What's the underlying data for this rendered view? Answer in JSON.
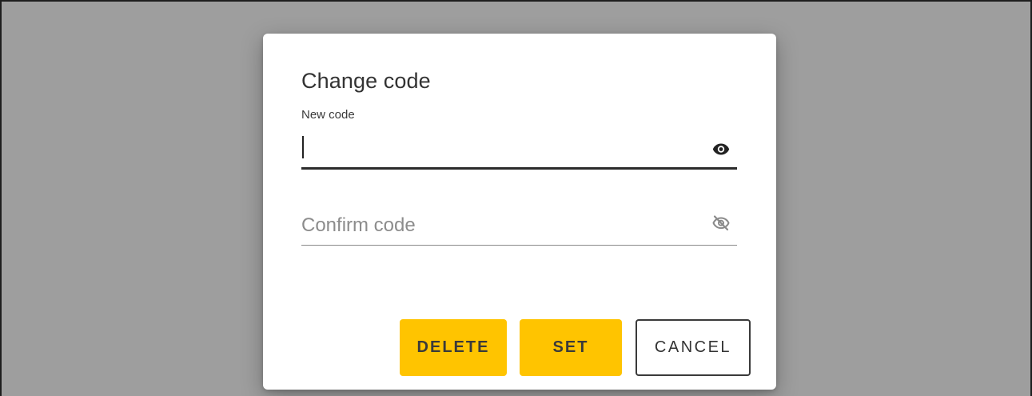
{
  "dialog": {
    "title": "Change code",
    "new_code": {
      "label": "New code",
      "value": "",
      "visibility_icon": "eye-icon"
    },
    "confirm_code": {
      "placeholder": "Confirm code",
      "value": "",
      "visibility_icon": "eye-off-icon"
    },
    "buttons": {
      "delete": "DELETE",
      "set": "SET",
      "cancel": "CANCEL"
    }
  },
  "colors": {
    "overlay": "#9e9e9e",
    "dialog_bg": "#ffffff",
    "accent": "#ffc400",
    "text": "#333333",
    "placeholder": "#8c8c8c"
  }
}
